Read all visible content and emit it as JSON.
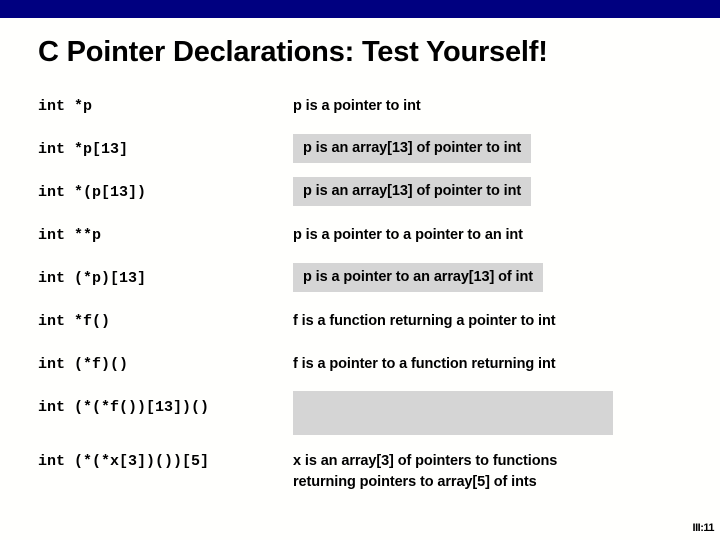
{
  "slide": {
    "title": "C Pointer Declarations: Test Yourself!",
    "page_number": "III:11",
    "accent_color": "#000080",
    "highlight_color": "#d5d5d5",
    "background_color": "#fffffd",
    "text_color": "#000000"
  },
  "rows": [
    {
      "code": "int *p",
      "description": "p is a pointer to int",
      "highlighted": false,
      "empty": false
    },
    {
      "code": "int *p[13]",
      "description": "p is an array[13] of pointer to int",
      "highlighted": true,
      "empty": false
    },
    {
      "code": "int *(p[13])",
      "description": "p is an array[13] of pointer to int",
      "highlighted": true,
      "empty": false
    },
    {
      "code": "int **p",
      "description": "p is a pointer to a pointer to an int",
      "highlighted": false,
      "empty": false
    },
    {
      "code": "int (*p)[13]",
      "description": "p is a pointer to an array[13] of int",
      "highlighted": true,
      "empty": false
    },
    {
      "code": "int *f()",
      "description": "f is a function returning a pointer to int",
      "highlighted": false,
      "empty": false
    },
    {
      "code": "int (*f)()",
      "description": "f is a pointer to a function returning int",
      "highlighted": false,
      "empty": false
    },
    {
      "code": "int (*(*f())[13])()",
      "description": "",
      "highlighted": true,
      "empty": true
    },
    {
      "code": "int (*(*x[3])())[5]",
      "description": "x is an array[3] of pointers  to functions\nreturning pointers to array[5] of ints",
      "highlighted": false,
      "empty": false
    }
  ]
}
